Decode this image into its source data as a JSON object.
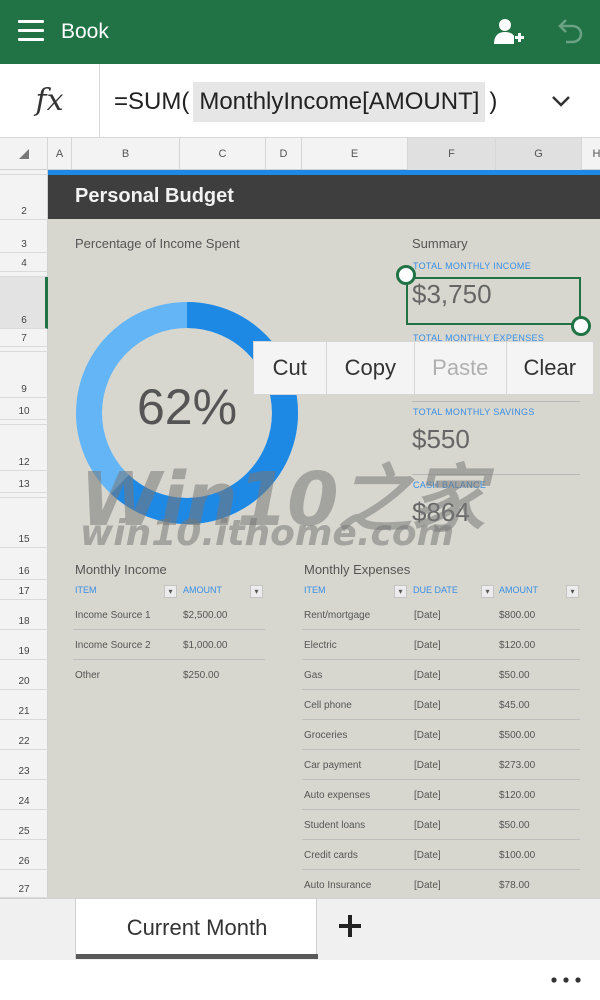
{
  "app": {
    "title": "Book"
  },
  "formula": {
    "fx": "fx",
    "prefix": "=SUM(",
    "reference": "MonthlyIncome[AMOUNT]",
    "suffix": ")"
  },
  "columns": [
    "A",
    "B",
    "C",
    "D",
    "E",
    "F",
    "G",
    "H"
  ],
  "rows": [
    "",
    "2",
    "3",
    "4",
    "",
    "6",
    "7",
    "",
    "9",
    "10",
    "",
    "12",
    "13",
    "",
    "15",
    "16",
    "17",
    "18",
    "19",
    "20",
    "21",
    "22",
    "23",
    "24",
    "25",
    "26",
    "27"
  ],
  "sheet": {
    "title": "Personal Budget",
    "chart_label": "Percentage of Income Spent",
    "summary_label": "Summary",
    "percent_spent": "62%",
    "percent_value": 62,
    "summary": [
      {
        "label": "TOTAL MONTHLY INCOME",
        "value": "$3,750"
      },
      {
        "label": "TOTAL MONTHLY EXPENSES",
        "value": ""
      },
      {
        "label": "TOTAL MONTHLY SAVINGS",
        "value": "$550"
      },
      {
        "label": "CASH BALANCE",
        "value": "$864"
      }
    ],
    "income": {
      "title": "Monthly Income",
      "headers": [
        "ITEM",
        "AMOUNT"
      ],
      "rows": [
        [
          "Income Source 1",
          "$2,500.00"
        ],
        [
          "Income Source 2",
          "$1,000.00"
        ],
        [
          "Other",
          "$250.00"
        ]
      ]
    },
    "expenses": {
      "title": "Monthly Expenses",
      "headers": [
        "ITEM",
        "DUE DATE",
        "AMOUNT"
      ],
      "rows": [
        [
          "Rent/mortgage",
          "[Date]",
          "$800.00"
        ],
        [
          "Electric",
          "[Date]",
          "$120.00"
        ],
        [
          "Gas",
          "[Date]",
          "$50.00"
        ],
        [
          "Cell phone",
          "[Date]",
          "$45.00"
        ],
        [
          "Groceries",
          "[Date]",
          "$500.00"
        ],
        [
          "Car payment",
          "[Date]",
          "$273.00"
        ],
        [
          "Auto expenses",
          "[Date]",
          "$120.00"
        ],
        [
          "Student loans",
          "[Date]",
          "$50.00"
        ],
        [
          "Credit cards",
          "[Date]",
          "$100.00"
        ],
        [
          "Auto Insurance",
          "[Date]",
          "$78.00"
        ]
      ]
    }
  },
  "context_menu": [
    {
      "label": "Cut",
      "enabled": true
    },
    {
      "label": "Copy",
      "enabled": true
    },
    {
      "label": "Paste",
      "enabled": false
    },
    {
      "label": "Clear",
      "enabled": true
    }
  ],
  "watermark": {
    "line1": "Win10之家",
    "line2": "win10.ithome.com"
  },
  "tabs": {
    "active": "Current Month",
    "add": "+"
  },
  "colors": {
    "brand": "#217346",
    "accent_blue": "#1e88e5",
    "donut_light": "#64b5f6"
  },
  "icons": {
    "menu": "hamburger-icon",
    "share": "add-person-icon",
    "undo": "undo-icon",
    "expand": "chevron-down-icon",
    "more": "ellipsis-icon"
  }
}
